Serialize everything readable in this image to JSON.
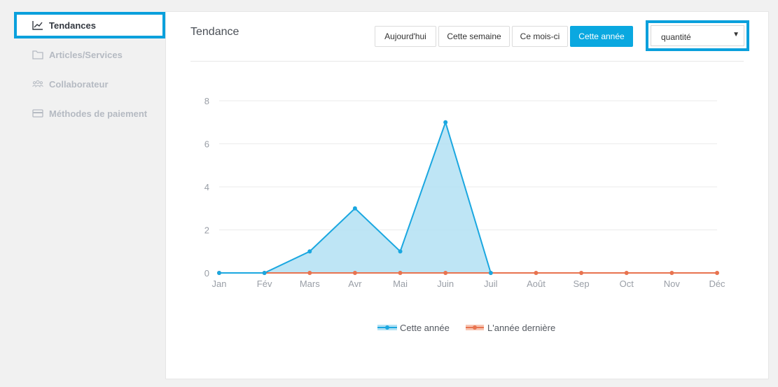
{
  "sidebar": {
    "items": [
      {
        "label": "Tendances",
        "icon": "trend-chart-icon",
        "active": true
      },
      {
        "label": "Articles/Services",
        "icon": "folder-icon",
        "active": false
      },
      {
        "label": "Collaborateur",
        "icon": "users-icon",
        "active": false
      },
      {
        "label": "Méthodes de paiement",
        "icon": "credit-card-icon",
        "active": false
      }
    ]
  },
  "panel": {
    "title": "Tendance",
    "periods": [
      {
        "label": "Aujourd'hui",
        "active": false
      },
      {
        "label": "Cette semaine",
        "active": false
      },
      {
        "label": "Ce mois-ci",
        "active": false
      },
      {
        "label": "Cette année",
        "active": true
      }
    ],
    "metric_select": {
      "value": "quantité"
    }
  },
  "colors": {
    "accent": "#0aa0dc",
    "series_current": "#1aa7e0",
    "series_current_fill": "#b3e1f3",
    "series_last": "#e8734f"
  },
  "chart_data": {
    "type": "area",
    "categories": [
      "Jan",
      "Fév",
      "Mars",
      "Avr",
      "Mai",
      "Juin",
      "Juil",
      "Août",
      "Sep",
      "Oct",
      "Nov",
      "Déc"
    ],
    "y_ticks": [
      0,
      2,
      4,
      6,
      8
    ],
    "ylim": [
      0,
      8
    ],
    "grid": true,
    "legend_position": "bottom",
    "series": [
      {
        "name": "Cette année",
        "values": [
          0,
          0,
          1,
          3,
          1,
          7,
          0,
          null,
          null,
          null,
          null,
          null
        ]
      },
      {
        "name": "L'année dernière",
        "values": [
          0,
          0,
          0,
          0,
          0,
          0,
          0,
          0,
          0,
          0,
          0,
          0
        ]
      }
    ]
  }
}
